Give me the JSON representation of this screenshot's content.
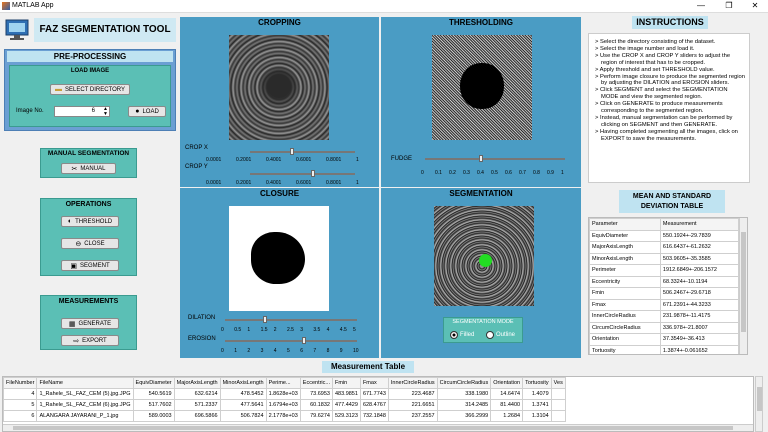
{
  "window": {
    "title": "MATLAB App",
    "minimize": "—",
    "restore": "❐",
    "close": "✕"
  },
  "app_title": "FAZ SEGMENTATION TOOL",
  "preprocessing": {
    "title": "PRE-PROCESSING",
    "load_image_title": "LOAD IMAGE",
    "select_dir_label": "SELECT DIRECTORY",
    "image_no_label": "Image No.",
    "image_no_value": "6",
    "load_label": "LOAD"
  },
  "manual_segmentation": {
    "title": "MANUAL SEGMENTATION",
    "manual_label": "MANUAL"
  },
  "operations": {
    "title": "OPERATIONS",
    "threshold_label": "THRESHOLD",
    "close_label": "CLOSE",
    "segment_label": "SEGMENT"
  },
  "measurements": {
    "title": "MEASUREMENTS",
    "generate_label": "GENERATE",
    "export_label": "EXPORT"
  },
  "cropping": {
    "title": "CROPPING",
    "crop_x_label": "CROP X",
    "crop_y_label": "CROP Y",
    "ticks": [
      "0.0001",
      "0.2001",
      "0.4001",
      "0.6001",
      "0.8001",
      "1"
    ],
    "crop_x_value": 0.4,
    "crop_y_value": 0.6
  },
  "thresholding": {
    "title": "THRESHOLDING",
    "fudge_label": "FUDGE",
    "ticks": [
      "0",
      "0.1",
      "0.2",
      "0.3",
      "0.4",
      "0.5",
      "0.6",
      "0.7",
      "0.8",
      "0.9",
      "1"
    ],
    "fudge_value": 0.4
  },
  "closure": {
    "title": "CLOSURE",
    "dilation_label": "DILATION",
    "dilation_ticks": [
      "0",
      "0.5",
      "1",
      "1.5",
      "2",
      "2.5",
      "3",
      "3.5",
      "4",
      "4.5",
      "5"
    ],
    "dilation_value": 1.5,
    "erosion_label": "EROSION",
    "erosion_ticks": [
      "0",
      "1",
      "2",
      "3",
      "4",
      "5",
      "6",
      "7",
      "8",
      "9",
      "10"
    ],
    "erosion_value": 6
  },
  "segmentation": {
    "title": "SEGMENTATION",
    "mode_title": "SEGMENTATION MODE",
    "filled_label": "Filled",
    "outline_label": "Outline",
    "selected_mode": "Filled"
  },
  "instructions": {
    "title": "INSTRUCTIONS",
    "items": [
      "Select the directory consisting of the dataset.",
      "Select the image number and load it.",
      "Use the CROP X and CROP Y sliders to adjust the region of interest that has to be cropped.",
      "Apply threshold and set THRESHOLD value.",
      "Perform image closure to produce the segmented region by adjusting the DILATION and EROSION sliders.",
      "Click SEGMENT and select the SEGMENTATION MODE and view the segmented region.",
      "Click on GENERATE to produce measurements corresponding to the segmented region.",
      "Instead, manual segmentation can be performed by clicking on SEGMENT and then GENERATE.",
      "Having completed segmenting all the images, click on EXPORT to save the measurements."
    ]
  },
  "mean_std": {
    "title_line1": "MEAN AND STANDARD",
    "title_line2": "DEVIATION TABLE",
    "headers": [
      "Parameter",
      "Measurement"
    ],
    "rows": [
      [
        "EquivDiameter",
        "550.1924+-29.7839"
      ],
      [
        "MajorAxisLength",
        "616.6437+-61.2632"
      ],
      [
        "MinorAxisLength",
        "503.9605+-35.3585"
      ],
      [
        "Perimeter",
        "1912.6849+-206.1572"
      ],
      [
        "Eccentricity",
        "68.3324+-10.1194"
      ],
      [
        "Fmin",
        "506.2467+-29.6718"
      ],
      [
        "Fmax",
        "671.2391+-44.3233"
      ],
      [
        "InnerCircleRadius",
        "231.9878+-11.4175"
      ],
      [
        "CircumCircleRadius",
        "336.978+-21.8007"
      ],
      [
        "Orientation",
        "37.3549+-36.413"
      ],
      [
        "Tortuosity",
        "1.3874+-0.061652"
      ]
    ]
  },
  "measurement_table": {
    "title": "Measurement Table",
    "headers": [
      "FileNumber",
      "FileName",
      "EquivDiameter",
      "MajorAxisLength",
      "MinorAxisLength",
      "Perime...",
      "Eccentric...",
      "Fmin",
      "Fmax",
      "InnerCircleRadius",
      "CircumCircleRadius",
      "Orientation",
      "Tortuosity",
      "Ves"
    ],
    "rows": [
      [
        "4",
        "1_Rahele_SL_FAZ_CEM (5).jpg.JPG",
        "540.5619",
        "632.6214",
        "478.5452",
        "1.8628e+03",
        "73.6953",
        "483.9851",
        "671.7743",
        "223.4687",
        "338.1980",
        "14.6474",
        "1.4079",
        ""
      ],
      [
        "5",
        "1_Rahele_SL_FAZ_CEM (6).jpg.JPG",
        "517.7602",
        "571.2337",
        "477.5641",
        "1.6794e+03",
        "60.1832",
        "477.4429",
        "628.4767",
        "221.6651",
        "314.2485",
        "81.4400",
        "1.3741",
        ""
      ],
      [
        "6",
        "ALANGARA JAYARANI_P_1.jpg",
        "589.0003",
        "696.5866",
        "506.7824",
        "2.1778e+03",
        "79.6274",
        "529.3123",
        "732.1848",
        "237.2557",
        "366.2999",
        "1.2684",
        "1.3104",
        ""
      ]
    ]
  }
}
